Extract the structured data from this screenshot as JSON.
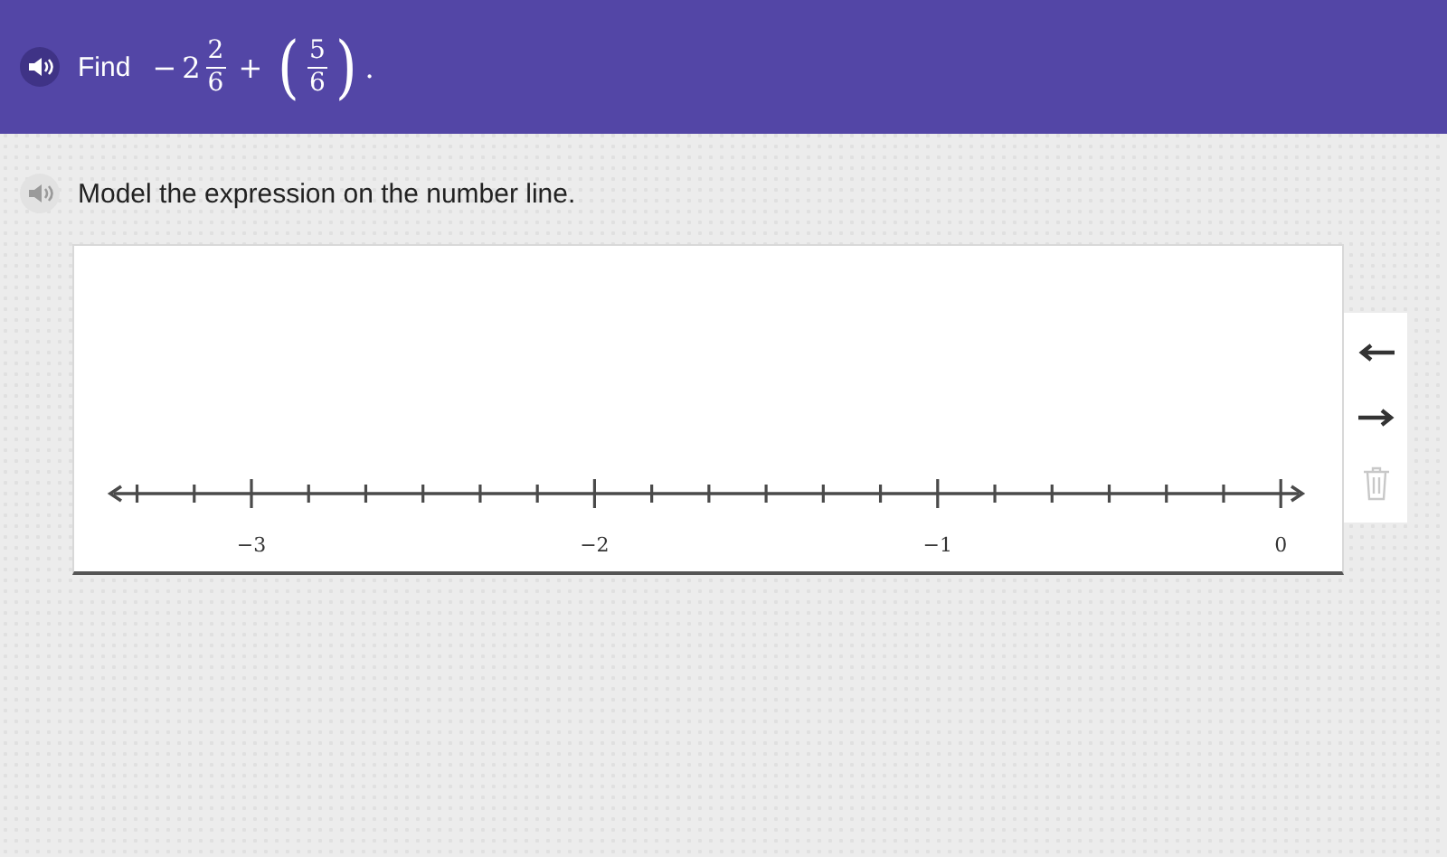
{
  "header": {
    "prompt": "Find",
    "expression": {
      "sign": "−",
      "whole": "2",
      "numerator": "2",
      "denominator": "6",
      "operator": "+",
      "open": "(",
      "numerator_2": "5",
      "denominator_2": "6",
      "close": ")",
      "end": "."
    }
  },
  "question": {
    "text": "Model the expression on the number line."
  },
  "number_line": {
    "labels": [
      "−3",
      "−2",
      "−1",
      "0"
    ]
  },
  "tools": [
    {
      "kind": "left",
      "disabled": false
    },
    {
      "kind": "right",
      "disabled": false
    },
    {
      "kind": "delete",
      "disabled": true
    }
  ]
}
